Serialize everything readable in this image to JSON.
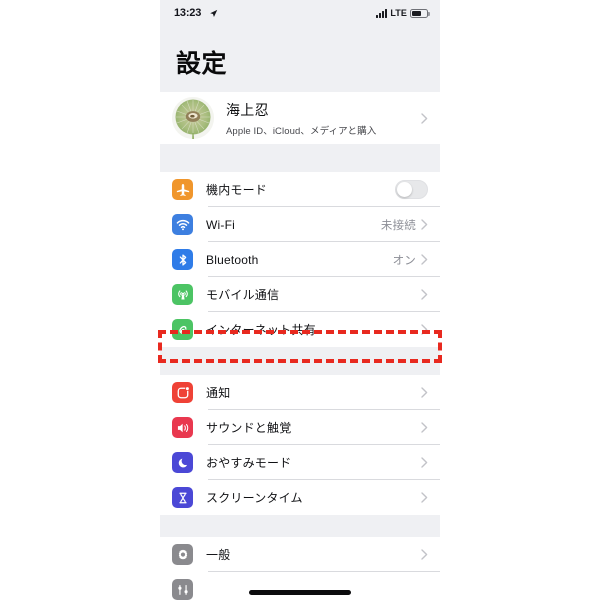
{
  "status_bar": {
    "time": "13:23",
    "location_icon": "location-arrow-icon",
    "signal_icon": "cellular-bars-icon",
    "network": "LTE",
    "battery_icon": "battery-icon"
  },
  "header": {
    "title": "設定"
  },
  "account": {
    "name": "海上忍",
    "subtitle": "Apple ID、iCloud、メディアと購入",
    "avatar_icon": "dandelion-avatar",
    "chevron": "chevron-right-icon"
  },
  "groups": [
    {
      "rows": [
        {
          "label": "機内モード",
          "icon": "airplane-icon",
          "icon_color": "#f0962c",
          "accessory": "toggle",
          "toggle_on": false,
          "value": ""
        },
        {
          "label": "Wi-Fi",
          "icon": "wifi-icon",
          "icon_color": "#3d7fe0",
          "accessory": "chevron",
          "value": "未接続"
        },
        {
          "label": "Bluetooth",
          "icon": "bluetooth-icon",
          "icon_color": "#2f7ce8",
          "accessory": "chevron",
          "value": "オン"
        },
        {
          "label": "モバイル通信",
          "icon": "cellular-antenna-icon",
          "icon_color": "#4cc464",
          "accessory": "chevron",
          "value": ""
        },
        {
          "label": "インターネット共有",
          "icon": "personal-hotspot-icon",
          "icon_color": "#4cc464",
          "accessory": "chevron",
          "value": "",
          "highlighted": true
        }
      ]
    },
    {
      "rows": [
        {
          "label": "通知",
          "icon": "notifications-icon",
          "icon_color": "#ef4236",
          "accessory": "chevron",
          "value": ""
        },
        {
          "label": "サウンドと触覚",
          "icon": "sounds-haptics-icon",
          "icon_color": "#e9384f",
          "accessory": "chevron",
          "value": ""
        },
        {
          "label": "おやすみモード",
          "icon": "do-not-disturb-moon-icon",
          "icon_color": "#4b48d6",
          "accessory": "chevron",
          "value": ""
        },
        {
          "label": "スクリーンタイム",
          "icon": "screen-time-hourglass-icon",
          "icon_color": "#4b48d6",
          "accessory": "chevron",
          "value": ""
        }
      ]
    },
    {
      "rows": [
        {
          "label": "一般",
          "icon": "general-gear-icon",
          "icon_color": "#8a8a8e",
          "accessory": "chevron",
          "value": ""
        }
      ]
    }
  ],
  "annotation": {
    "type": "red-dashed-highlight",
    "target": "インターネット共有",
    "color": "#e8291f"
  },
  "home_indicator": "home-indicator-bar",
  "colors": {
    "group_background": "#eff0f3",
    "row_background": "#ffffff",
    "separator": "#d9dade",
    "secondary_text": "#8c8e96",
    "annotation_red": "#e8291f"
  }
}
